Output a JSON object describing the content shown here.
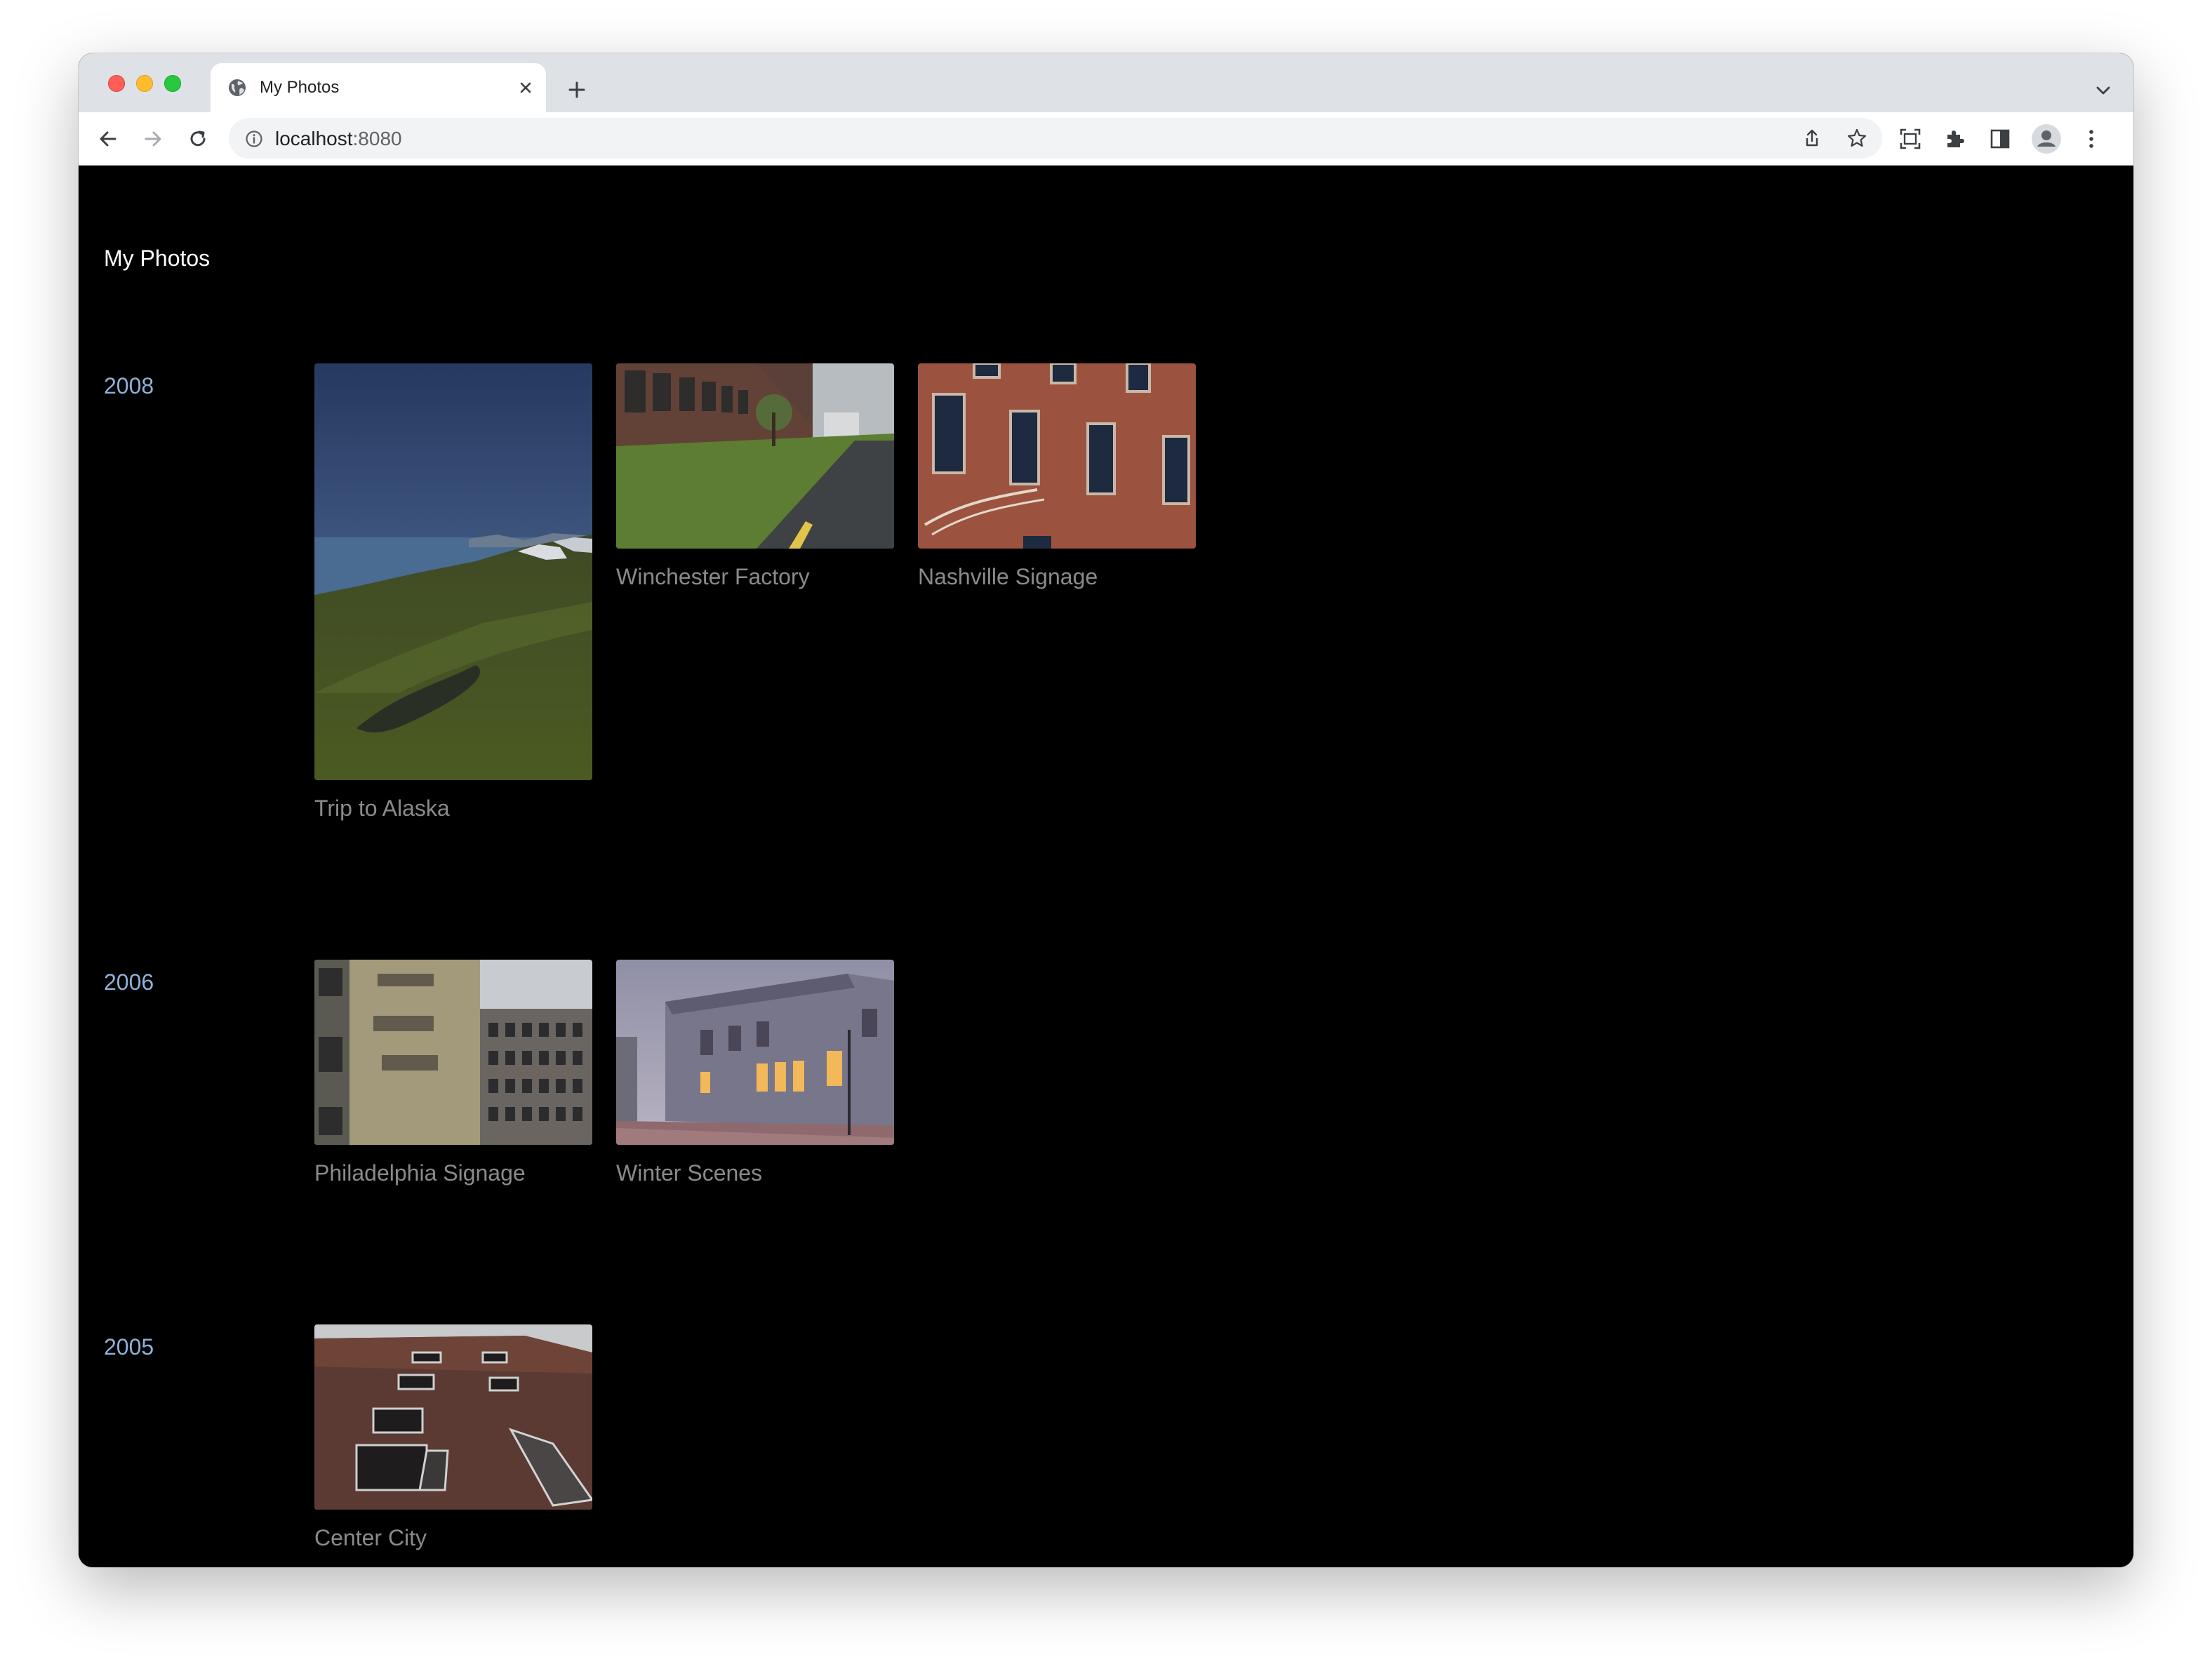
{
  "browser": {
    "tab_title": "My Photos",
    "url_host": "localhost",
    "url_port": ":8080"
  },
  "site": {
    "title": "My Photos"
  },
  "years": [
    {
      "label": "2008",
      "albums": [
        {
          "title": "Trip to Alaska",
          "thumbnail": "alaska-mountain-coast"
        },
        {
          "title": "Winchester Factory",
          "thumbnail": "factory-bike-path"
        },
        {
          "title": "Nashville Signage",
          "thumbnail": "brick-building-windows"
        }
      ]
    },
    {
      "label": "2006",
      "albums": [
        {
          "title": "Philadelphia Signage",
          "thumbnail": "faded-wall-signage"
        },
        {
          "title": "Winter Scenes",
          "thumbnail": "stone-building-dusk"
        }
      ]
    },
    {
      "label": "2005",
      "albums": [
        {
          "title": "Center City",
          "thumbnail": "brick-facade-shutters"
        }
      ]
    }
  ],
  "colors": {
    "page_background": "#000000",
    "year_link": "#8fb1d9",
    "album_title": "#8a8a8a"
  }
}
